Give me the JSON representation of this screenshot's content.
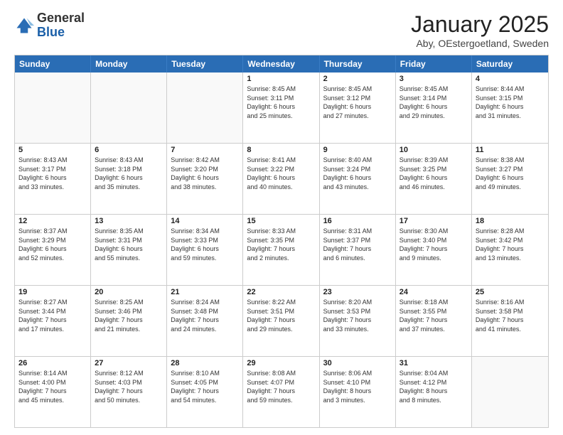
{
  "logo": {
    "general": "General",
    "blue": "Blue"
  },
  "header": {
    "month": "January 2025",
    "location": "Aby, OEstergoetland, Sweden"
  },
  "day_headers": [
    "Sunday",
    "Monday",
    "Tuesday",
    "Wednesday",
    "Thursday",
    "Friday",
    "Saturday"
  ],
  "weeks": [
    [
      {
        "date": "",
        "info": "",
        "empty": true
      },
      {
        "date": "",
        "info": "",
        "empty": true
      },
      {
        "date": "",
        "info": "",
        "empty": true
      },
      {
        "date": "1",
        "info": "Sunrise: 8:45 AM\nSunset: 3:11 PM\nDaylight: 6 hours\nand 25 minutes.",
        "empty": false
      },
      {
        "date": "2",
        "info": "Sunrise: 8:45 AM\nSunset: 3:12 PM\nDaylight: 6 hours\nand 27 minutes.",
        "empty": false
      },
      {
        "date": "3",
        "info": "Sunrise: 8:45 AM\nSunset: 3:14 PM\nDaylight: 6 hours\nand 29 minutes.",
        "empty": false
      },
      {
        "date": "4",
        "info": "Sunrise: 8:44 AM\nSunset: 3:15 PM\nDaylight: 6 hours\nand 31 minutes.",
        "empty": false
      }
    ],
    [
      {
        "date": "5",
        "info": "Sunrise: 8:43 AM\nSunset: 3:17 PM\nDaylight: 6 hours\nand 33 minutes.",
        "empty": false
      },
      {
        "date": "6",
        "info": "Sunrise: 8:43 AM\nSunset: 3:18 PM\nDaylight: 6 hours\nand 35 minutes.",
        "empty": false
      },
      {
        "date": "7",
        "info": "Sunrise: 8:42 AM\nSunset: 3:20 PM\nDaylight: 6 hours\nand 38 minutes.",
        "empty": false
      },
      {
        "date": "8",
        "info": "Sunrise: 8:41 AM\nSunset: 3:22 PM\nDaylight: 6 hours\nand 40 minutes.",
        "empty": false
      },
      {
        "date": "9",
        "info": "Sunrise: 8:40 AM\nSunset: 3:24 PM\nDaylight: 6 hours\nand 43 minutes.",
        "empty": false
      },
      {
        "date": "10",
        "info": "Sunrise: 8:39 AM\nSunset: 3:25 PM\nDaylight: 6 hours\nand 46 minutes.",
        "empty": false
      },
      {
        "date": "11",
        "info": "Sunrise: 8:38 AM\nSunset: 3:27 PM\nDaylight: 6 hours\nand 49 minutes.",
        "empty": false
      }
    ],
    [
      {
        "date": "12",
        "info": "Sunrise: 8:37 AM\nSunset: 3:29 PM\nDaylight: 6 hours\nand 52 minutes.",
        "empty": false
      },
      {
        "date": "13",
        "info": "Sunrise: 8:35 AM\nSunset: 3:31 PM\nDaylight: 6 hours\nand 55 minutes.",
        "empty": false
      },
      {
        "date": "14",
        "info": "Sunrise: 8:34 AM\nSunset: 3:33 PM\nDaylight: 6 hours\nand 59 minutes.",
        "empty": false
      },
      {
        "date": "15",
        "info": "Sunrise: 8:33 AM\nSunset: 3:35 PM\nDaylight: 7 hours\nand 2 minutes.",
        "empty": false
      },
      {
        "date": "16",
        "info": "Sunrise: 8:31 AM\nSunset: 3:37 PM\nDaylight: 7 hours\nand 6 minutes.",
        "empty": false
      },
      {
        "date": "17",
        "info": "Sunrise: 8:30 AM\nSunset: 3:40 PM\nDaylight: 7 hours\nand 9 minutes.",
        "empty": false
      },
      {
        "date": "18",
        "info": "Sunrise: 8:28 AM\nSunset: 3:42 PM\nDaylight: 7 hours\nand 13 minutes.",
        "empty": false
      }
    ],
    [
      {
        "date": "19",
        "info": "Sunrise: 8:27 AM\nSunset: 3:44 PM\nDaylight: 7 hours\nand 17 minutes.",
        "empty": false
      },
      {
        "date": "20",
        "info": "Sunrise: 8:25 AM\nSunset: 3:46 PM\nDaylight: 7 hours\nand 21 minutes.",
        "empty": false
      },
      {
        "date": "21",
        "info": "Sunrise: 8:24 AM\nSunset: 3:48 PM\nDaylight: 7 hours\nand 24 minutes.",
        "empty": false
      },
      {
        "date": "22",
        "info": "Sunrise: 8:22 AM\nSunset: 3:51 PM\nDaylight: 7 hours\nand 29 minutes.",
        "empty": false
      },
      {
        "date": "23",
        "info": "Sunrise: 8:20 AM\nSunset: 3:53 PM\nDaylight: 7 hours\nand 33 minutes.",
        "empty": false
      },
      {
        "date": "24",
        "info": "Sunrise: 8:18 AM\nSunset: 3:55 PM\nDaylight: 7 hours\nand 37 minutes.",
        "empty": false
      },
      {
        "date": "25",
        "info": "Sunrise: 8:16 AM\nSunset: 3:58 PM\nDaylight: 7 hours\nand 41 minutes.",
        "empty": false
      }
    ],
    [
      {
        "date": "26",
        "info": "Sunrise: 8:14 AM\nSunset: 4:00 PM\nDaylight: 7 hours\nand 45 minutes.",
        "empty": false
      },
      {
        "date": "27",
        "info": "Sunrise: 8:12 AM\nSunset: 4:03 PM\nDaylight: 7 hours\nand 50 minutes.",
        "empty": false
      },
      {
        "date": "28",
        "info": "Sunrise: 8:10 AM\nSunset: 4:05 PM\nDaylight: 7 hours\nand 54 minutes.",
        "empty": false
      },
      {
        "date": "29",
        "info": "Sunrise: 8:08 AM\nSunset: 4:07 PM\nDaylight: 7 hours\nand 59 minutes.",
        "empty": false
      },
      {
        "date": "30",
        "info": "Sunrise: 8:06 AM\nSunset: 4:10 PM\nDaylight: 8 hours\nand 3 minutes.",
        "empty": false
      },
      {
        "date": "31",
        "info": "Sunrise: 8:04 AM\nSunset: 4:12 PM\nDaylight: 8 hours\nand 8 minutes.",
        "empty": false
      },
      {
        "date": "",
        "info": "",
        "empty": true
      }
    ]
  ]
}
